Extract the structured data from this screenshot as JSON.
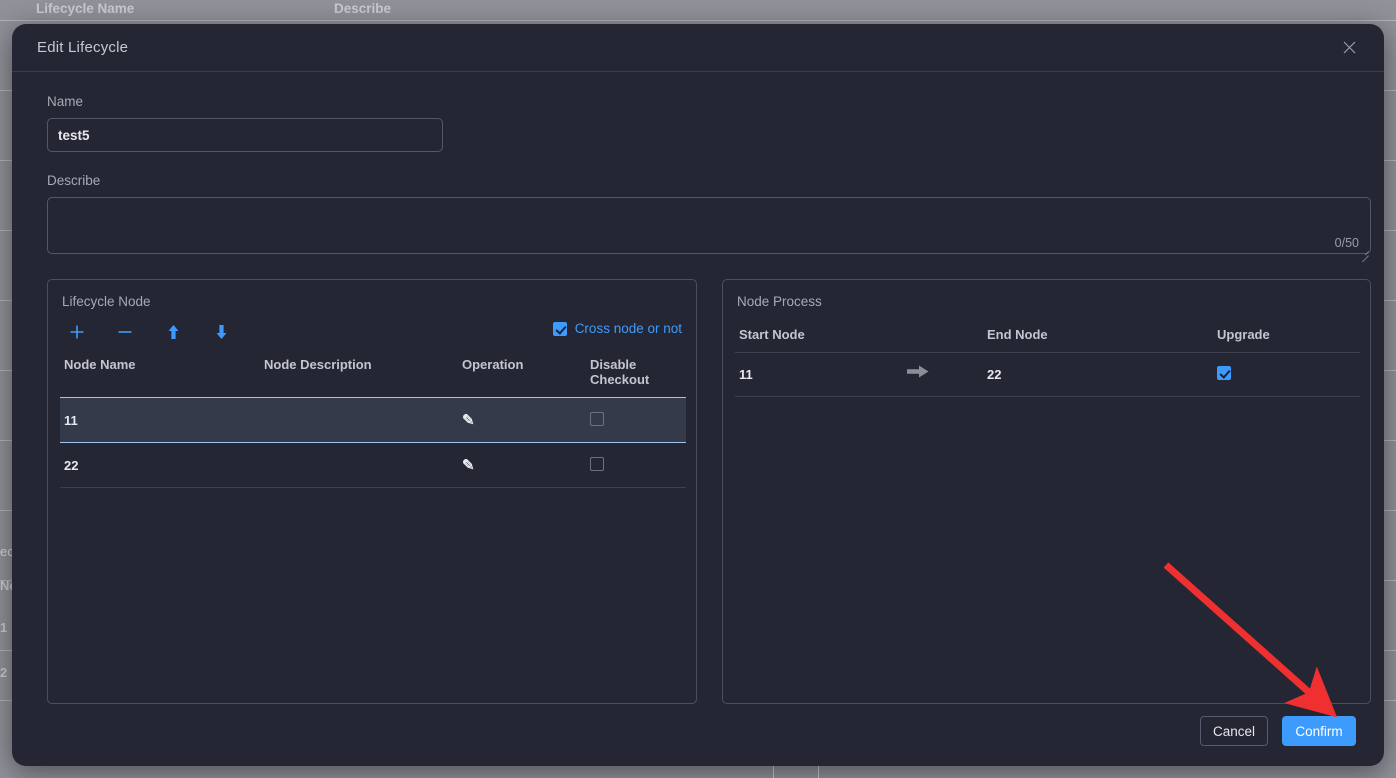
{
  "background": {
    "columns": [
      "Lifecycle Name",
      "Describe"
    ],
    "left_edge_labels": [
      "ecy",
      "No",
      "1",
      "2"
    ]
  },
  "modal": {
    "title": "Edit Lifecycle",
    "close_icon": "close-icon",
    "name": {
      "label": "Name",
      "value": "test5",
      "placeholder": ""
    },
    "describe": {
      "label": "Describe",
      "value": "",
      "placeholder": "",
      "counter": "0/50"
    },
    "lifecycle_node": {
      "caption": "Lifecycle Node",
      "toolbar": [
        {
          "name": "add-node-button",
          "icon": "plus-icon"
        },
        {
          "name": "remove-node-button",
          "icon": "minus-icon"
        },
        {
          "name": "move-up-button",
          "icon": "arrow-up-icon"
        },
        {
          "name": "move-down-button",
          "icon": "arrow-down-icon"
        }
      ],
      "cross_node": {
        "label": "Cross node or not",
        "checked": true
      },
      "columns": [
        "Node Name",
        "Node Description",
        "Operation",
        "Disable Checkout"
      ],
      "rows": [
        {
          "node_name": "11",
          "node_description": "",
          "operation_icon": "pencil-icon",
          "disable_checkout": false,
          "selected": true
        },
        {
          "node_name": "22",
          "node_description": "",
          "operation_icon": "pencil-icon",
          "disable_checkout": false,
          "selected": false
        }
      ]
    },
    "node_process": {
      "caption": "Node Process",
      "columns": [
        "Start Node",
        "End Node",
        "Upgrade"
      ],
      "rows": [
        {
          "start_node": "11",
          "arrow_icon": "arrow-right-icon",
          "end_node": "22",
          "upgrade": true
        }
      ]
    },
    "footer": {
      "cancel_label": "Cancel",
      "confirm_label": "Confirm"
    }
  },
  "colors": {
    "accent": "#3d9bfd",
    "modal_bg": "#252633",
    "page_bg": "#909199",
    "selected_row": "#343a4a",
    "annotation_arrow": "#f03030"
  },
  "annotation": {
    "name": "red-arrow-annotation",
    "points_to": "Confirm"
  }
}
